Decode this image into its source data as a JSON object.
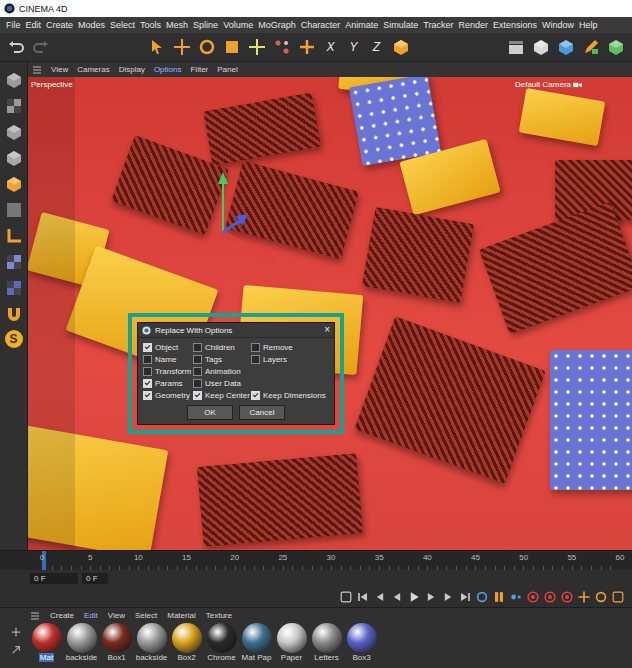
{
  "window": {
    "title": "CINEMA 4D"
  },
  "menu": [
    "File",
    "Edit",
    "Create",
    "Modes",
    "Select",
    "Tools",
    "Mesh",
    "Spline",
    "Volume",
    "MoGraph",
    "Character",
    "Animate",
    "Simulate",
    "Tracker",
    "Render",
    "Extensions",
    "Window",
    "Help"
  ],
  "toolbar": {
    "axes": [
      "X",
      "Y",
      "Z"
    ]
  },
  "left_toolbar": {
    "snap_label": "S"
  },
  "viewport": {
    "menu": [
      {
        "label": "View",
        "selected": false
      },
      {
        "label": "Cameras",
        "selected": false
      },
      {
        "label": "Display",
        "selected": false
      },
      {
        "label": "Options",
        "selected": true
      },
      {
        "label": "Filter",
        "selected": false
      },
      {
        "label": "Panel",
        "selected": false
      }
    ],
    "view_name": "Perspective",
    "camera": "Default Camera"
  },
  "dialog": {
    "title": "Replace With Options",
    "close": "×",
    "rows": [
      [
        {
          "label": "Object",
          "checked": true
        },
        {
          "label": "Children",
          "checked": false
        },
        {
          "label": "Remove",
          "checked": false
        }
      ],
      [
        {
          "label": "Name",
          "checked": false
        },
        {
          "label": "Tags",
          "checked": false
        },
        {
          "label": "Layers",
          "checked": false
        }
      ],
      [
        {
          "label": "Transform",
          "checked": false
        },
        {
          "label": "Animation",
          "checked": false
        }
      ],
      [
        {
          "label": "Params",
          "checked": true
        },
        {
          "label": "User Data",
          "checked": false
        }
      ],
      [
        {
          "label": "Geometry",
          "checked": true
        },
        {
          "label": "Keep Center",
          "checked": true
        },
        {
          "label": "Keep Dimensions",
          "checked": true
        }
      ]
    ],
    "buttons": [
      "OK",
      "Cancel"
    ]
  },
  "timeline": {
    "ticks": [
      "0",
      "5",
      "10",
      "15",
      "20",
      "25",
      "30",
      "35",
      "40",
      "45",
      "50",
      "55",
      "60"
    ],
    "level": 0,
    "fields": [
      "0 F",
      "0 F"
    ]
  },
  "material_manager": {
    "menu": [
      {
        "label": "Create",
        "selected": false
      },
      {
        "label": "Edit",
        "selected": true
      },
      {
        "label": "View",
        "selected": false
      },
      {
        "label": "Select",
        "selected": false
      },
      {
        "label": "Material",
        "selected": false
      },
      {
        "label": "Texture",
        "selected": false
      }
    ],
    "materials": [
      {
        "name": "Mat",
        "selected": true,
        "color": "#c0302a"
      },
      {
        "name": "backside",
        "selected": false,
        "color": "#9a9a9a"
      },
      {
        "name": "Box1",
        "selected": false,
        "color": "#7a2a1e"
      },
      {
        "name": "backside",
        "selected": false,
        "color": "#9a9a9a"
      },
      {
        "name": "Box2",
        "selected": false,
        "color": "#d9a21e"
      },
      {
        "name": "Chrome",
        "selected": false,
        "color": "#2a2a2a"
      },
      {
        "name": "Mat Pap",
        "selected": false,
        "color": "#3f6f8f"
      },
      {
        "name": "Paper",
        "selected": false,
        "color": "#c8c8c8"
      },
      {
        "name": "Letters",
        "selected": false,
        "color": "#8a8a8a"
      },
      {
        "name": "Box3",
        "selected": false,
        "color": "#5a62c8"
      }
    ]
  }
}
